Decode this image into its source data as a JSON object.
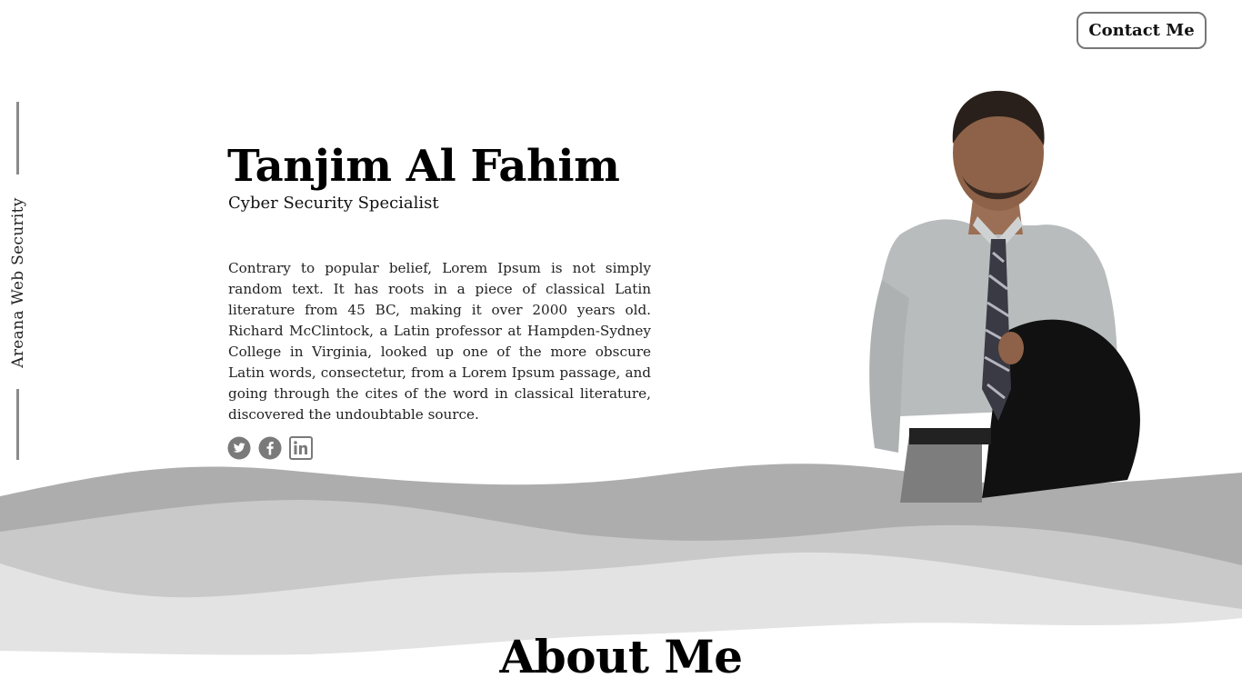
{
  "header": {
    "contact_label": "Contact Me"
  },
  "sidebar": {
    "brand_text": "Areana Web Security"
  },
  "hero": {
    "name": "Tanjim Al Fahim",
    "role": "Cyber Security Specialist",
    "bio": "Contrary to popular belief, Lorem Ipsum is not simply random text. It has roots in a piece of classical Latin literature from 45 BC, making it over 2000 years old. Richard McClintock, a Latin professor at Hampden-Sydney College in Virginia, looked up one of the more obscure Latin words, consectetur, from a Lorem Ipsum passage, and going through the cites of the word in classical literature, discovered the undoubtable source."
  },
  "social": {
    "icons": [
      "twitter-icon",
      "facebook-icon",
      "linkedin-icon"
    ]
  },
  "sections": {
    "about_title": "About Me"
  },
  "colors": {
    "wave_dark": "#adadad",
    "wave_mid": "#c9c9c9",
    "wave_light": "#e3e3e3",
    "icon_gray": "#7a7a7a"
  }
}
